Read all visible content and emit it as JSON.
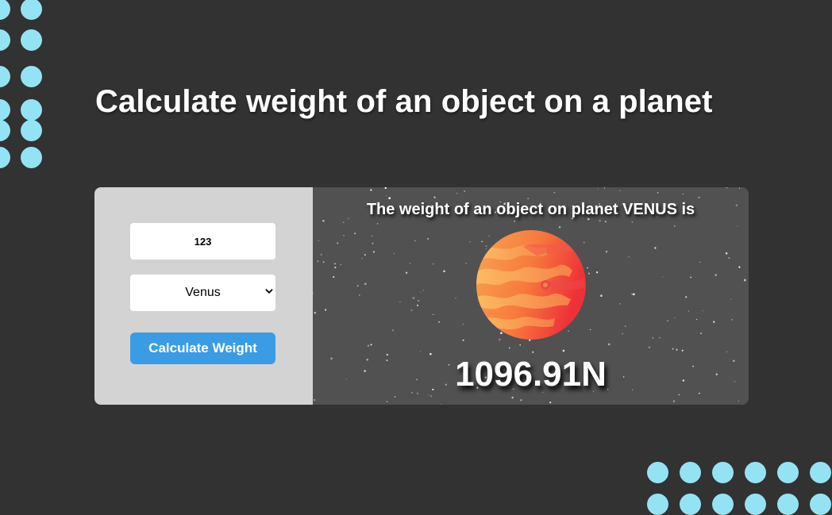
{
  "page": {
    "title": "Calculate weight of an object on a planet"
  },
  "form": {
    "mass_value": "123",
    "planet_selected": "Venus",
    "calculate_label": "Calculate Weight"
  },
  "result": {
    "caption": "The weight of an object on planet VENUS is",
    "value": "1096.91N",
    "planet_icon": "venus-planet-icon"
  },
  "colors": {
    "background": "#323232",
    "accent_dots": "#94e3f5",
    "form_panel": "#d3d3d3",
    "result_panel": "#515151",
    "button": "#3a9ce4"
  }
}
